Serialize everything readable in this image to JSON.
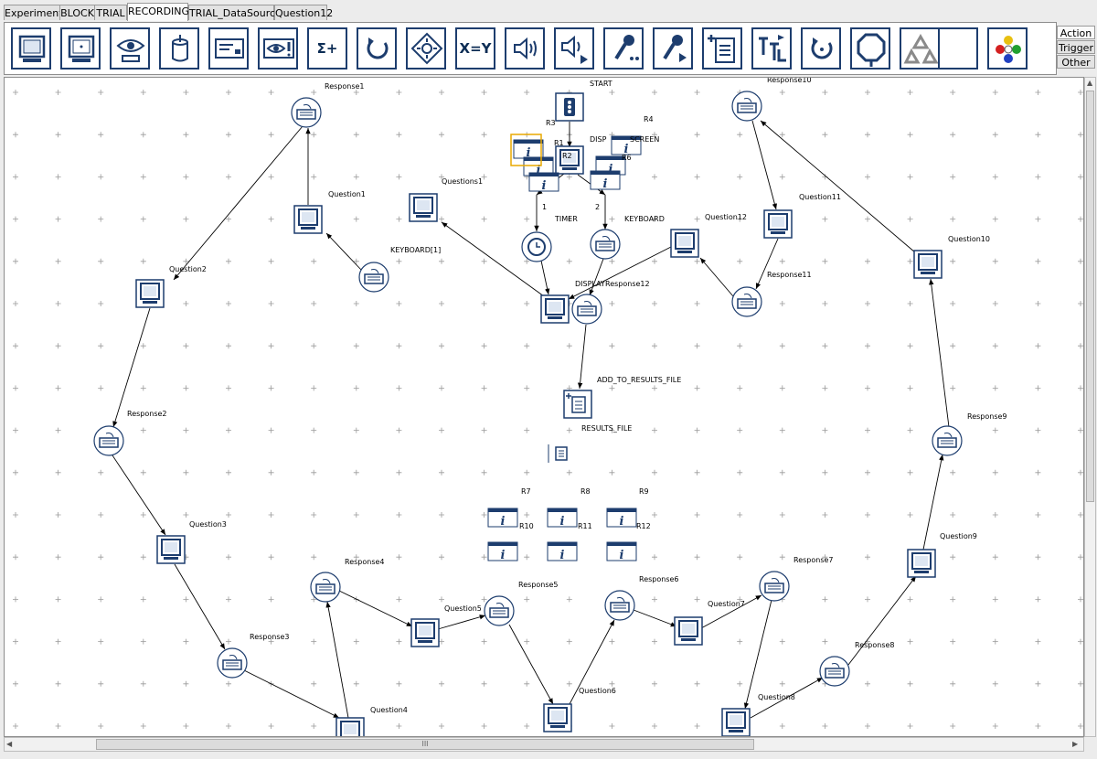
{
  "tabs": [
    {
      "label": "Experiment",
      "active": false
    },
    {
      "label": "BLOCK",
      "active": false
    },
    {
      "label": "TRIAL",
      "active": false
    },
    {
      "label": "RECORDING",
      "active": true
    },
    {
      "label": "TRIAL_DataSource",
      "active": false
    },
    {
      "label": "Question12",
      "active": false
    }
  ],
  "toolbar": {
    "items": [
      {
        "name": "display-screen-tool",
        "icon": "monitor"
      },
      {
        "name": "display-point-tool",
        "icon": "monitor-dot"
      },
      {
        "name": "eye-tracker-tool",
        "icon": "eye-tracker"
      },
      {
        "name": "cylinder-tool",
        "icon": "cylinder"
      },
      {
        "name": "send-message-tool",
        "icon": "message"
      },
      {
        "name": "eye-alert-tool",
        "icon": "eye-alert"
      },
      {
        "name": "sum-tool",
        "icon": "sigma",
        "text": "Σ+"
      },
      {
        "name": "loop-tool",
        "icon": "loop"
      },
      {
        "name": "move-tool",
        "icon": "move"
      },
      {
        "name": "update-attribute-tool",
        "icon": "equals",
        "text": "X=Y"
      },
      {
        "name": "play-sound-tool",
        "icon": "speaker"
      },
      {
        "name": "play-sound-control-tool",
        "icon": "speaker-play"
      },
      {
        "name": "record-sound-tool",
        "icon": "microphone"
      },
      {
        "name": "record-sound-control-tool",
        "icon": "microphone-play"
      },
      {
        "name": "add-to-results-tool",
        "icon": "results-add"
      },
      {
        "name": "ttl-tool",
        "icon": "ttl"
      },
      {
        "name": "recycle-loop-tool",
        "icon": "loop-dot"
      },
      {
        "name": "terminate-tool",
        "icon": "stop-sign"
      },
      {
        "name": "recycle-data-tool",
        "icon": "recycle"
      },
      {
        "name": "blank-tool",
        "icon": "blank"
      },
      {
        "name": "custom-class-tool",
        "icon": "color-dots"
      }
    ]
  },
  "side_tabs": [
    {
      "label": "Action",
      "active": true
    },
    {
      "label": "Trigger",
      "active": false
    },
    {
      "label": "Other",
      "active": false
    }
  ],
  "nodes": {
    "start": "START",
    "r1": "R1",
    "r2": "R2",
    "r3": "R3",
    "r4": "R4",
    "r6": "R6",
    "disp": "DISP",
    "screen": "SCREEN",
    "timer": "TIMER",
    "keyboard": "KEYBOARD",
    "edge1": "1",
    "edge2": "2",
    "display": "DISPLAY",
    "response12": "Response12",
    "add_results": "ADD_TO_RESULTS_FILE",
    "results_file": "RESULTS_FILE",
    "r7": "R7",
    "r8": "R8",
    "r9": "R9",
    "r10": "R10",
    "r11": "R11",
    "r12": "R12",
    "keyboard1": "KEYBOARD[1]",
    "question1": "Question1",
    "questions1": "Questions1",
    "response1": "Response1",
    "question2": "Question2",
    "response2": "Response2",
    "question3": "Question3",
    "response3": "Response3",
    "question4": "Question4",
    "response4": "Response4",
    "question5": "Question5",
    "response5": "Response5",
    "question6": "Question6",
    "response6": "Response6",
    "question7": "Question7",
    "response7": "Response7",
    "question8": "Question8",
    "response8": "Response8",
    "question9": "Question9",
    "response9": "Response9",
    "question10": "Question10",
    "response10": "Response10",
    "question11": "Question11",
    "response11": "Response11",
    "question12": "Question12"
  },
  "scroll": {
    "grip": "III"
  },
  "colors": {
    "node_blue": "#1d3d6e",
    "grid": "#9a9a9a",
    "select": "#e8a800"
  }
}
